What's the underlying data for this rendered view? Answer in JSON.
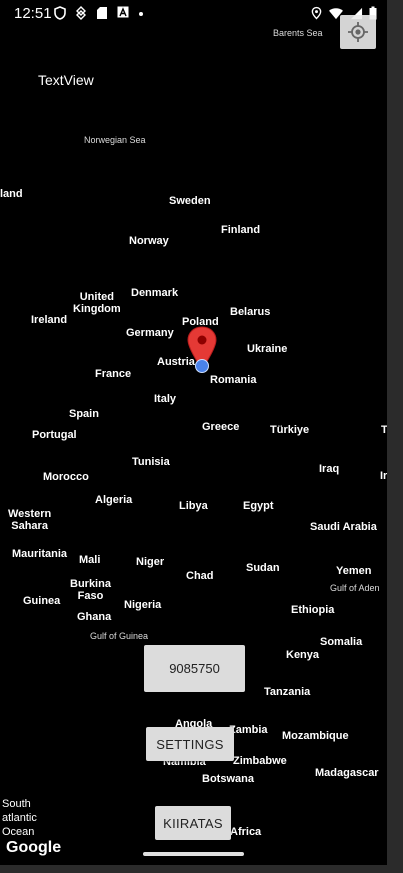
{
  "status_bar": {
    "time": "12:51",
    "icons_left": [
      "shield-icon",
      "data-saver-icon",
      "sd-card-icon",
      "notification-a-icon",
      "dot-icon"
    ],
    "icons_right": [
      "location-icon",
      "wifi-icon",
      "signal-icon",
      "battery-icon"
    ]
  },
  "textview": "TextView",
  "map": {
    "sea_labels": {
      "barents": "Barents Sea",
      "norwegian": "Norwegian Sea",
      "aden": "Gulf of Aden",
      "guinea_gulf": "Gulf of Guinea",
      "south_atlantic": "South\natlantic\nOcean"
    },
    "country_labels": {
      "finland_edge": "land",
      "sweden": "Sweden",
      "finland": "Finland",
      "norway": "Norway",
      "uk": "United\nKingdom",
      "denmark": "Denmark",
      "ireland": "Ireland",
      "poland": "Poland",
      "belarus": "Belarus",
      "germany": "Germany",
      "ukraine": "Ukraine",
      "austria": "Austria",
      "france": "France",
      "romania": "Romania",
      "italy": "Italy",
      "spain": "Spain",
      "greece": "Greece",
      "turkiye": "Türkiye",
      "t_edge": "T",
      "portugal": "Portugal",
      "tunisia": "Tunisia",
      "iraq": "Iraq",
      "ir_edge": "Ir",
      "morocco": "Morocco",
      "algeria": "Algeria",
      "libya": "Libya",
      "egypt": "Egypt",
      "western_sahara": "Western\nSahara",
      "saudi_arabia": "Saudi Arabia",
      "mauritania": "Mauritania",
      "mali": "Mali",
      "niger": "Niger",
      "sudan": "Sudan",
      "chad": "Chad",
      "yemen": "Yemen",
      "burkina": "Burkina\nFaso",
      "guinea": "Guinea",
      "nigeria": "Nigeria",
      "ethiopia": "Ethiopia",
      "ghana": "Ghana",
      "somalia": "Somalia",
      "kenya": "Kenya",
      "tanzania": "Tanzania",
      "angola": "Angola",
      "zambia": "Zambia",
      "mozambique": "Mozambique",
      "namibia": "Namibia",
      "zimbabwe": "Zimbabwe",
      "madagascar": "Madagascar",
      "botswana": "Botswana",
      "africa": "Africa"
    },
    "marker_color": "#e53935",
    "my_location_color": "#4a82ea"
  },
  "buttons": {
    "counter": "9085750",
    "settings": "SETTINGS",
    "kiiratas": "KIIRATAS"
  },
  "google_logo": "Google"
}
